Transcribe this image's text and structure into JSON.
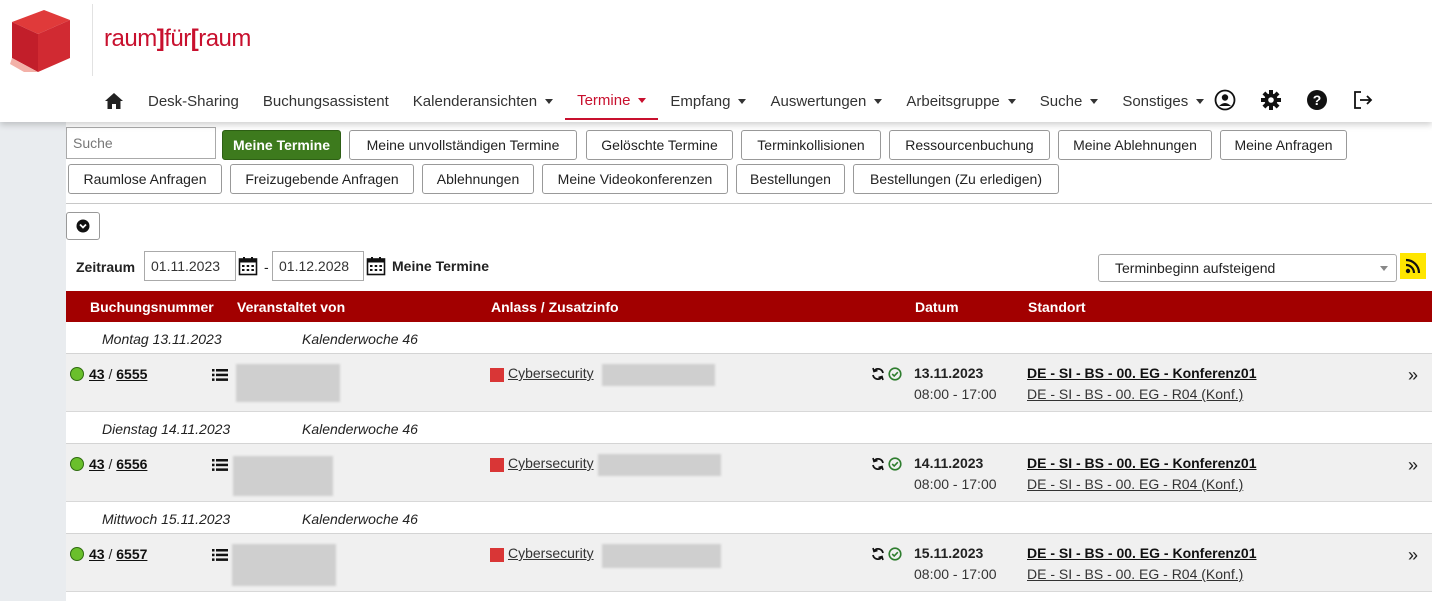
{
  "brand": {
    "logo_text_part1": "raum",
    "logo_text_bracket1": "]",
    "logo_text_part2": "für",
    "logo_text_bracket2": "[",
    "logo_text_part3": "raum",
    "accent": "#c8102e"
  },
  "nav": {
    "items": [
      {
        "label": "Desk-Sharing",
        "has_caret": false
      },
      {
        "label": "Buchungsassistent",
        "has_caret": false
      },
      {
        "label": "Kalenderansichten",
        "has_caret": true
      },
      {
        "label": "Termine",
        "has_caret": true,
        "active": true
      },
      {
        "label": "Empfang",
        "has_caret": true
      },
      {
        "label": "Auswertungen",
        "has_caret": true
      },
      {
        "label": "Arbeitsgruppe",
        "has_caret": true
      },
      {
        "label": "Suche",
        "has_caret": true
      },
      {
        "label": "Sonstiges",
        "has_caret": true
      }
    ],
    "right_icons": [
      "user-icon",
      "gear-icon",
      "help-icon",
      "logout-icon"
    ]
  },
  "search": {
    "placeholder": "Suche"
  },
  "buttons_row1": [
    "Meine Termine",
    "Meine unvollständigen Termine",
    "Gelöschte Termine",
    "Terminkollisionen",
    "Ressourcenbuchung",
    "Meine Ablehnungen",
    "Meine Anfragen"
  ],
  "buttons_row2": [
    "Raumlose Anfragen",
    "Freizugebende Anfragen",
    "Ablehnungen",
    "Meine Videokonferenzen",
    "Bestellungen",
    "Bestellungen (Zu erledigen)"
  ],
  "filter": {
    "zeitraum_label": "Zeitraum",
    "date_from": "01.11.2023",
    "date_dash": "-",
    "date_to": "01.12.2028",
    "meine_termine_label": "Meine Termine",
    "sort_value": "Terminbeginn aufsteigend"
  },
  "table": {
    "headers": [
      "Buchungsnummer",
      "Veranstaltet von",
      "Anlass / Zusatzinfo",
      "Datum",
      "Standort"
    ],
    "header_color": "#a20000",
    "groups": [
      {
        "day": "Montag 13.11.2023",
        "week": "Kalenderwoche 46",
        "booking_a": "43",
        "booking_sep": "/",
        "booking_b": "6555",
        "anlass": "Cybersecurity",
        "date": "13.11.2023",
        "time": "08:00 - 17:00",
        "location1": "DE - SI - BS - 00. EG - Konferenz01",
        "location2": "DE - SI - BS - 00. EG - R04 (Konf.)"
      },
      {
        "day": "Dienstag 14.11.2023",
        "week": "Kalenderwoche 46",
        "booking_a": "43",
        "booking_sep": "/",
        "booking_b": "6556",
        "anlass": "Cybersecurity",
        "date": "14.11.2023",
        "time": "08:00 - 17:00",
        "location1": "DE - SI - BS - 00. EG - Konferenz01",
        "location2": "DE - SI - BS - 00. EG - R04 (Konf.)"
      },
      {
        "day": "Mittwoch 15.11.2023",
        "week": "Kalenderwoche 46",
        "booking_a": "43",
        "booking_sep": "/",
        "booking_b": "6557",
        "anlass": "Cybersecurity",
        "date": "15.11.2023",
        "time": "08:00 - 17:00",
        "location1": "DE - SI - BS - 00. EG - Konferenz01",
        "location2": "DE - SI - BS - 00. EG - R04 (Konf.)"
      }
    ]
  }
}
